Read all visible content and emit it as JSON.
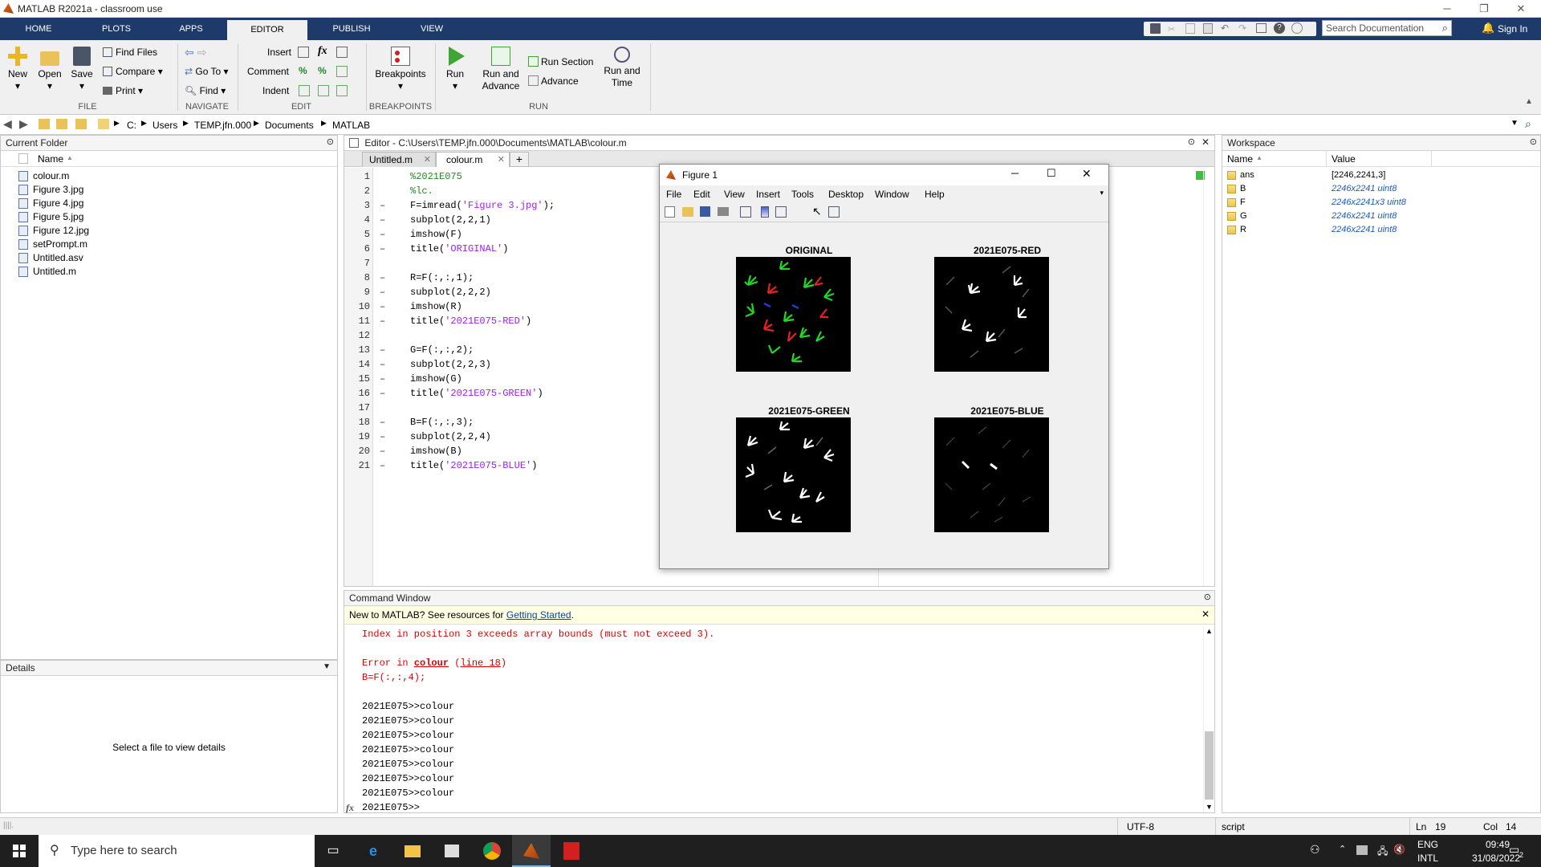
{
  "window": {
    "title": "MATLAB R2021a - classroom use"
  },
  "tabs": [
    "HOME",
    "PLOTS",
    "APPS",
    "EDITOR",
    "PUBLISH",
    "VIEW"
  ],
  "ribbon": {
    "file": {
      "new": "New",
      "open": "Open",
      "save": "Save",
      "find_files": "Find Files",
      "compare": "Compare",
      "print": "Print",
      "group": "FILE"
    },
    "navigate": {
      "goto": "Go To",
      "find": "Find",
      "group": "NAVIGATE"
    },
    "edit": {
      "insert": "Insert",
      "comment": "Comment",
      "indent": "Indent",
      "group": "EDIT",
      "fx": "fx"
    },
    "breakpoints": {
      "label": "Breakpoints",
      "group": "BREAKPOINTS"
    },
    "run": {
      "run": "Run",
      "run_advance_1": "Run and",
      "run_advance_2": "Advance",
      "run_section": "Run Section",
      "advance": "Advance",
      "run_time_1": "Run and",
      "run_time_2": "Time",
      "group": "RUN"
    },
    "search_placeholder": "Search Documentation",
    "sign_in": "Sign In"
  },
  "address": {
    "crumbs": [
      "C:",
      "Users",
      "TEMP.jfn.000",
      "Documents",
      "MATLAB"
    ]
  },
  "current_folder": {
    "title": "Current Folder",
    "column": "Name",
    "files": [
      "colour.m",
      "Figure 3.jpg",
      "Figure 4.jpg",
      "Figure 5.jpg",
      "Figure 12.jpg",
      "setPrompt.m",
      "Untitled.asv",
      "Untitled.m"
    ]
  },
  "details": {
    "title": "Details",
    "empty": "Select a file to view details"
  },
  "editor": {
    "title": "Editor - C:\\Users\\TEMP.jfn.000\\Documents\\MATLAB\\colour.m",
    "tabs": [
      "Untitled.m",
      "colour.m"
    ],
    "plus": "+",
    "lines": [
      {
        "n": "1",
        "d": "",
        "t": "%2021E075",
        "k": "cmt"
      },
      {
        "n": "2",
        "d": "",
        "t": "%lc.",
        "k": "cmt"
      },
      {
        "n": "3",
        "d": "–",
        "t": "F=imread(",
        "s": "'Figure 3.jpg'",
        "e": ");"
      },
      {
        "n": "4",
        "d": "–",
        "t": "subplot(2,2,1)"
      },
      {
        "n": "5",
        "d": "–",
        "t": "imshow(F)"
      },
      {
        "n": "6",
        "d": "–",
        "t": "title(",
        "s": "'ORIGINAL'",
        "e": ")"
      },
      {
        "n": "7",
        "d": "",
        "t": ""
      },
      {
        "n": "8",
        "d": "–",
        "t": "R=F(:,:,1);"
      },
      {
        "n": "9",
        "d": "–",
        "t": "subplot(2,2,2)"
      },
      {
        "n": "10",
        "d": "–",
        "t": "imshow(R)"
      },
      {
        "n": "11",
        "d": "–",
        "t": "title(",
        "s": "'2021E075-RED'",
        "e": ")"
      },
      {
        "n": "12",
        "d": "",
        "t": ""
      },
      {
        "n": "13",
        "d": "–",
        "t": "G=F(:,:,2);"
      },
      {
        "n": "14",
        "d": "–",
        "t": "subplot(2,2,3)"
      },
      {
        "n": "15",
        "d": "–",
        "t": "imshow(G)"
      },
      {
        "n": "16",
        "d": "–",
        "t": "title(",
        "s": "'2021E075-GREEN'",
        "e": ")"
      },
      {
        "n": "17",
        "d": "",
        "t": ""
      },
      {
        "n": "18",
        "d": "–",
        "t": "B=F(:,:,3);"
      },
      {
        "n": "19",
        "d": "–",
        "t": "subplot(2,2,4)"
      },
      {
        "n": "20",
        "d": "–",
        "t": "imshow(B)"
      },
      {
        "n": "21",
        "d": "–",
        "t": "title(",
        "s": "'2021E075-BLUE'",
        "e": ")"
      }
    ]
  },
  "figure": {
    "title": "Figure 1",
    "menu": [
      "File",
      "Edit",
      "View",
      "Insert",
      "Tools",
      "Desktop",
      "Window",
      "Help"
    ],
    "subplots": [
      "ORIGINAL",
      "2021E075-RED",
      "2021E075-GREEN",
      "2021E075-BLUE"
    ]
  },
  "command_window": {
    "title": "Command Window",
    "banner_text": "New to MATLAB? See resources for ",
    "banner_link": "Getting Started",
    "banner_end": ".",
    "err1": "Index in position 3 exceeds array bounds (must not exceed 3).",
    "err2_a": "Error in ",
    "err2_b": "colour",
    "err2_c": " (",
    "err2_d": "line 18",
    "err2_e": ")",
    "err3": "B=F(:,:,4);",
    "history": [
      "2021E075>>colour",
      "2021E075>>colour",
      "2021E075>>colour",
      "2021E075>>colour",
      "2021E075>>colour",
      "2021E075>>colour",
      "2021E075>>colour"
    ],
    "prompt": "2021E075>>",
    "fx": "fx"
  },
  "workspace": {
    "title": "Workspace",
    "cols": [
      "Name",
      "Value"
    ],
    "vars": [
      {
        "name": "ans",
        "value": "[2246,2241,3]",
        "link": false
      },
      {
        "name": "B",
        "value": "2246x2241 uint8",
        "link": true
      },
      {
        "name": "F",
        "value": "2246x2241x3 uint8",
        "link": true
      },
      {
        "name": "G",
        "value": "2246x2241 uint8",
        "link": true
      },
      {
        "name": "R",
        "value": "2246x2241 uint8",
        "link": true
      }
    ]
  },
  "status": {
    "encoding": "UTF-8",
    "type": "script",
    "ln_label": "Ln",
    "ln": "19",
    "col_label": "Col",
    "col": "14"
  },
  "taskbar": {
    "search": "Type here to search",
    "lang1": "ENG",
    "lang2": "INTL",
    "time": "09:49",
    "date": "31/08/2022",
    "notif": "2"
  }
}
